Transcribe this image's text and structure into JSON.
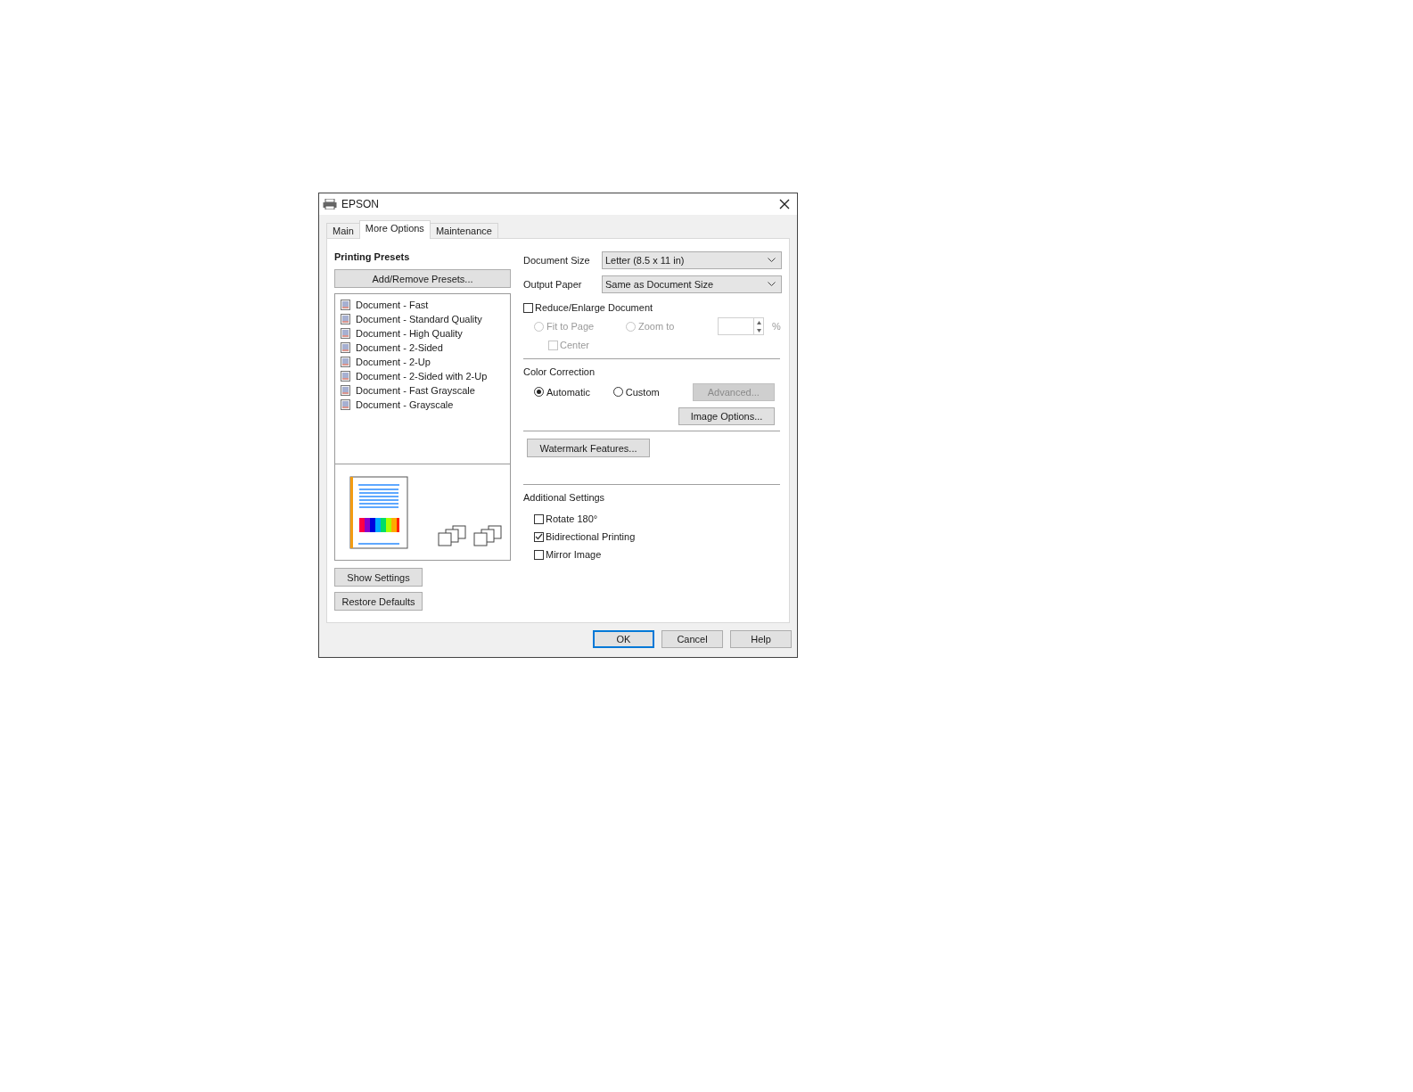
{
  "window": {
    "title": "EPSON"
  },
  "tabs": [
    {
      "label": "Main",
      "selected": false
    },
    {
      "label": "More Options",
      "selected": true
    },
    {
      "label": "Maintenance",
      "selected": false
    }
  ],
  "presets": {
    "title": "Printing Presets",
    "add_button": "Add/Remove Presets...",
    "items": [
      {
        "label": "Document - Fast"
      },
      {
        "label": "Document - Standard Quality"
      },
      {
        "label": "Document - High Quality"
      },
      {
        "label": "Document - 2-Sided"
      },
      {
        "label": "Document - 2-Up"
      },
      {
        "label": "Document - 2-Sided with 2-Up"
      },
      {
        "label": "Document - Fast Grayscale"
      },
      {
        "label": "Document - Grayscale"
      }
    ]
  },
  "show_settings_button": "Show Settings",
  "restore_defaults_button": "Restore Defaults",
  "document_size": {
    "label": "Document Size",
    "value": "Letter (8.5 x 11 in)"
  },
  "output_paper": {
    "label": "Output Paper",
    "value": "Same as Document Size"
  },
  "reduce_enlarge": {
    "label": "Reduce/Enlarge Document",
    "checked": false
  },
  "scale_options": [
    {
      "label": "Fit to Page",
      "selected": false,
      "disabled": true
    },
    {
      "label": "Zoom to",
      "selected": false,
      "disabled": true
    }
  ],
  "zoom_unit": {
    "label": "%",
    "disabled": true
  },
  "center": {
    "label": "Center",
    "checked": false,
    "disabled": true
  },
  "color_correction": {
    "title": "Color Correction",
    "options": [
      {
        "label": "Automatic",
        "selected": true
      },
      {
        "label": "Custom",
        "selected": false
      }
    ],
    "advanced_button": {
      "label": "Advanced...",
      "disabled": true
    },
    "image_options_button": "Image Options..."
  },
  "watermark_button": "Watermark Features...",
  "additional_settings": {
    "title": "Additional Settings",
    "items": [
      {
        "label": "Rotate 180°",
        "checked": false
      },
      {
        "label": "Bidirectional Printing",
        "checked": true
      },
      {
        "label": "Mirror Image",
        "checked": false
      }
    ]
  },
  "buttons": [
    {
      "label": "OK",
      "default": true
    },
    {
      "label": "Cancel",
      "default": false
    },
    {
      "label": "Help",
      "default": false
    }
  ]
}
